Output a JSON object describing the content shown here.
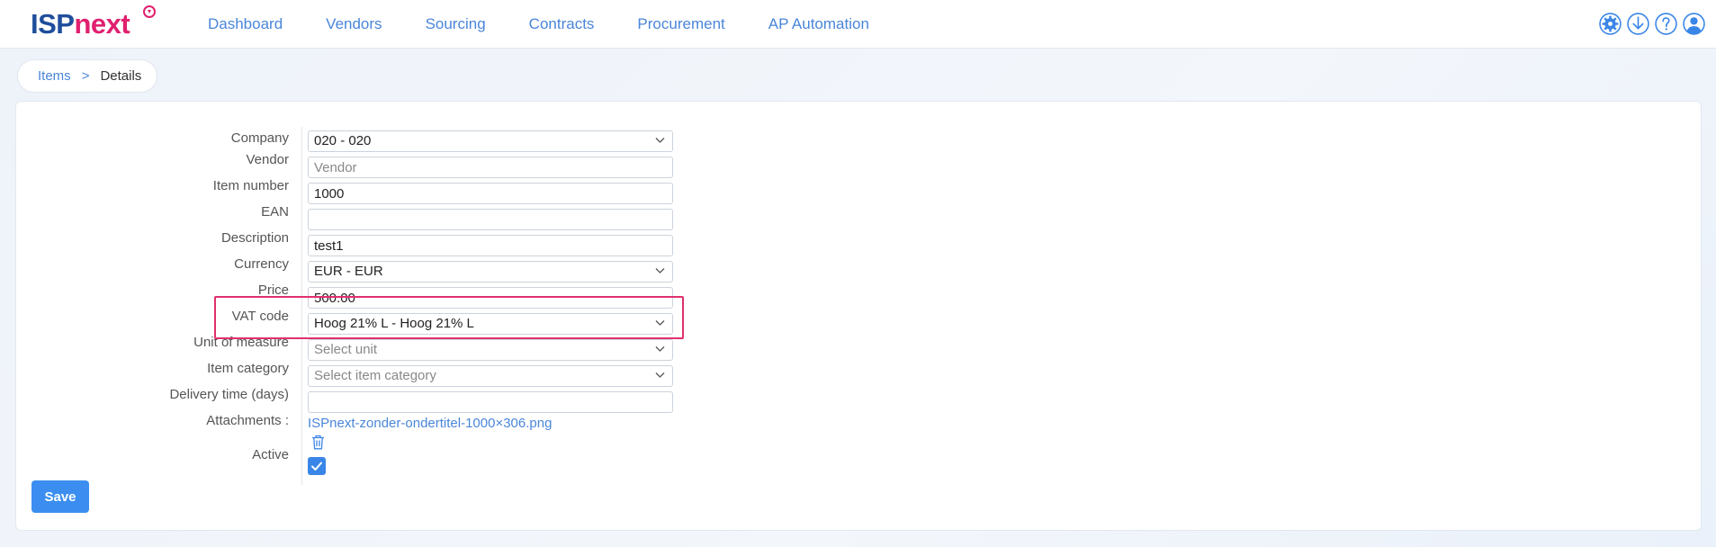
{
  "app": {
    "logo_part1": "ISP",
    "logo_part2": "next",
    "brand_color": "#1f4e9c",
    "accent_color": "#e0206f",
    "link_color": "#4a86d9"
  },
  "nav": {
    "items": [
      "Dashboard",
      "Vendors",
      "Sourcing",
      "Contracts",
      "Procurement",
      "AP Automation"
    ]
  },
  "header_icons": [
    "settings-icon",
    "download-icon",
    "help-icon",
    "user-icon"
  ],
  "breadcrumb": {
    "items_label": "Items",
    "separator": ">",
    "current": "Details"
  },
  "form": {
    "company": {
      "label": "Company",
      "value": "020 - 020"
    },
    "vendor": {
      "label": "Vendor",
      "placeholder": "Vendor",
      "value": ""
    },
    "item_number": {
      "label": "Item number",
      "value": "1000"
    },
    "ean": {
      "label": "EAN",
      "value": ""
    },
    "description": {
      "label": "Description",
      "value": "test1"
    },
    "currency": {
      "label": "Currency",
      "value": "EUR - EUR"
    },
    "price": {
      "label": "Price",
      "value": "500.00"
    },
    "vat_code": {
      "label": "VAT code",
      "value": "Hoog 21% L - Hoog 21% L"
    },
    "unit_of_measure": {
      "label": "Unit of measure",
      "placeholder": "Select unit"
    },
    "item_category": {
      "label": "Item category",
      "placeholder": "Select item category"
    },
    "delivery_time": {
      "label": "Delivery time (days)",
      "value": ""
    },
    "attachments": {
      "label": "Attachments :",
      "file_name": "ISPnext-zonder-ondertitel-1000×306.png"
    },
    "active": {
      "label": "Active",
      "checked": true
    }
  },
  "buttons": {
    "save": "Save"
  },
  "highlight_color": "#e0306f"
}
